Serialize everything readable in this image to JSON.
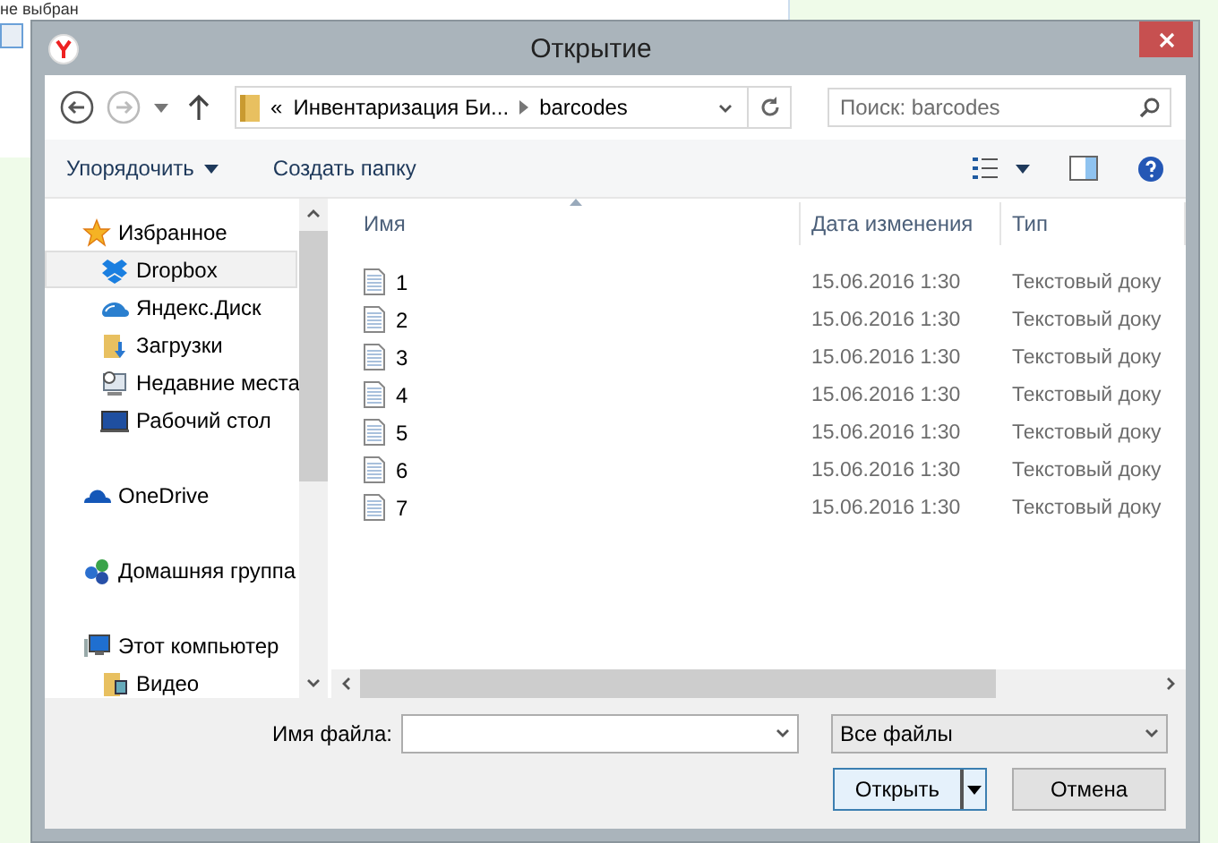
{
  "background_app": {
    "text": "не выбран"
  },
  "window": {
    "title": "Открытие"
  },
  "nav": {
    "path_prefix": "«",
    "path_segments": [
      "Инвентаризация Би...",
      "barcodes"
    ],
    "search": {
      "placeholder": "Поиск: barcodes"
    }
  },
  "toolbar": {
    "buttons": [
      {
        "label": "Упорядочить",
        "dropdown": true
      },
      {
        "label": "Создать папку",
        "dropdown": false
      }
    ]
  },
  "sidebar": {
    "groups": [
      {
        "label": "Избранное",
        "kind": "star",
        "selected": false,
        "children": [
          {
            "label": "Dropbox",
            "kind": "dropbox",
            "selected": true
          },
          {
            "label": "Яндекс.Диск",
            "kind": "cloud",
            "selected": false
          },
          {
            "label": "Загрузки",
            "kind": "downloads",
            "selected": false
          },
          {
            "label": "Недавние места",
            "kind": "recent",
            "selected": false
          },
          {
            "label": "Рабочий стол",
            "kind": "desktop",
            "selected": false
          }
        ]
      },
      {
        "label": "OneDrive",
        "kind": "onedrive",
        "selected": false
      },
      {
        "label": "Домашняя группа",
        "kind": "homegroup",
        "selected": false
      },
      {
        "label": "Этот компьютер",
        "kind": "computer",
        "selected": false,
        "children": [
          {
            "label": "Видео",
            "kind": "video",
            "selected": false
          }
        ]
      }
    ]
  },
  "table": {
    "columns": [
      "Имя",
      "Дата изменения",
      "Тип"
    ],
    "rows": [
      {
        "name": "1",
        "date": "15.06.2016 1:30",
        "type": "Текстовый доку"
      },
      {
        "name": "2",
        "date": "15.06.2016 1:30",
        "type": "Текстовый доку"
      },
      {
        "name": "3",
        "date": "15.06.2016 1:30",
        "type": "Текстовый доку"
      },
      {
        "name": "4",
        "date": "15.06.2016 1:30",
        "type": "Текстовый доку"
      },
      {
        "name": "5",
        "date": "15.06.2016 1:30",
        "type": "Текстовый доку"
      },
      {
        "name": "6",
        "date": "15.06.2016 1:30",
        "type": "Текстовый доку"
      },
      {
        "name": "7",
        "date": "15.06.2016 1:30",
        "type": "Текстовый доку"
      }
    ]
  },
  "footer": {
    "filename_label": "Имя файла:",
    "filetype": "Все файлы",
    "open_button": "Открыть",
    "cancel_button": "Отмена"
  }
}
